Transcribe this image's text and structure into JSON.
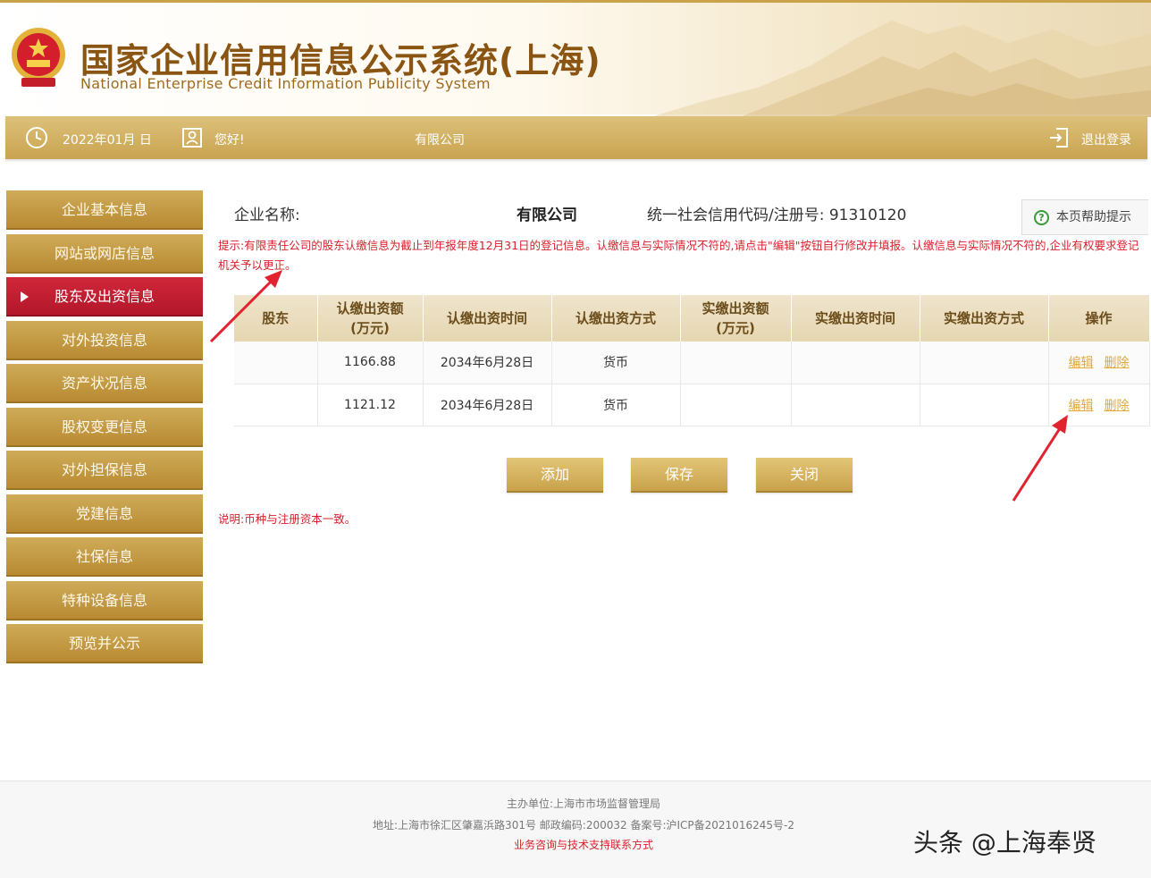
{
  "header": {
    "title": "国家企业信用信息公示系统(上海)",
    "subtitle": "National Enterprise Credit Information Publicity System"
  },
  "topbar": {
    "date": "2022年01月  日",
    "greeting": "您好!",
    "company": "有限公司",
    "logout": "退出登录"
  },
  "sidebar": {
    "items": [
      {
        "label": "企业基本信息"
      },
      {
        "label": "网站或网店信息"
      },
      {
        "label": "股东及出资信息",
        "active": true
      },
      {
        "label": "对外投资信息"
      },
      {
        "label": "资产状况信息"
      },
      {
        "label": "股权变更信息"
      },
      {
        "label": "对外担保信息"
      },
      {
        "label": "党建信息"
      },
      {
        "label": "社保信息"
      },
      {
        "label": "特种设备信息"
      },
      {
        "label": "预览并公示"
      }
    ]
  },
  "main": {
    "company_label": "企业名称:",
    "company_name": "有限公司",
    "credit_code": "统一社会信用代码/注册号: 91310120",
    "help_label": "本页帮助提示",
    "notice": "提示:有限责任公司的股东认缴信息为截止到年报年度12月31日的登记信息。认缴信息与实际情况不符的,请点击\"编辑\"按钮自行修改并填报。认缴信息与实际情况不符的,企业有权要求登记机关予以更正。",
    "table": {
      "headers": [
        "股东",
        "认缴出资额\n(万元)",
        "认缴出资时间",
        "认缴出资方式",
        "实缴出资额\n(万元)",
        "实缴出资时间",
        "实缴出资方式",
        "操作"
      ],
      "rows": [
        {
          "shareholder": "",
          "sub_amount": "1166.88",
          "sub_date": "2034年6月28日",
          "sub_method": "货币",
          "paid_amount": "",
          "paid_date": "",
          "paid_method": ""
        },
        {
          "shareholder": "",
          "sub_amount": "1121.12",
          "sub_date": "2034年6月28日",
          "sub_method": "货币",
          "paid_amount": "",
          "paid_date": "",
          "paid_method": ""
        }
      ],
      "edit_label": "编辑",
      "delete_label": "删除"
    },
    "buttons": {
      "add": "添加",
      "save": "保存",
      "close": "关闭"
    },
    "explain": "说明:币种与注册资本一致。"
  },
  "footer": {
    "sponsor": "主办单位:上海市市场监督管理局",
    "address": "地址:上海市徐汇区肇嘉浜路301号  邮政编码:200032  备案号:沪ICP备2021016245号-2",
    "support": "业务咨询与技术支持联系方式"
  },
  "watermark": "头条 @上海奉贤",
  "colors": {
    "gold": "#c9a24a",
    "red": "#d9202c",
    "active": "#c41e30",
    "brown": "#8a5512"
  },
  "icons": [
    "national-emblem-icon",
    "clock-icon",
    "user-card-icon",
    "logout-icon",
    "help-icon",
    "arrow-annotation-icon"
  ]
}
